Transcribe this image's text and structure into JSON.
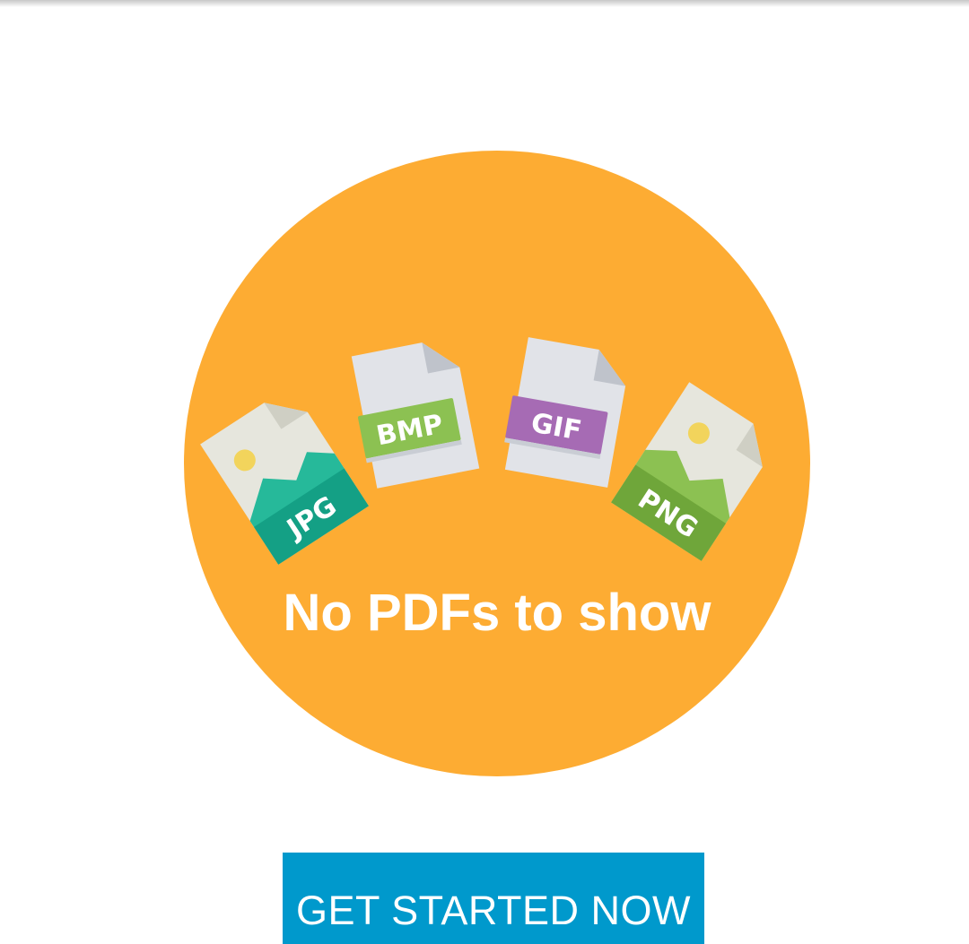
{
  "empty_state": {
    "message": "No PDFs to show",
    "circle_color": "#FDAC33",
    "file_types": [
      {
        "label": "JPG",
        "icon": "jpg-file-icon",
        "tag_color": "#14A085"
      },
      {
        "label": "BMP",
        "icon": "bmp-file-icon",
        "tag_color": "#8CC152"
      },
      {
        "label": "GIF",
        "icon": "gif-file-icon",
        "tag_color": "#A66BB4"
      },
      {
        "label": "PNG",
        "icon": "png-file-icon",
        "tag_color": "#6FA63A"
      }
    ]
  },
  "actions": {
    "get_started_label": "GET STARTED NOW",
    "button_color": "#0099CC"
  }
}
